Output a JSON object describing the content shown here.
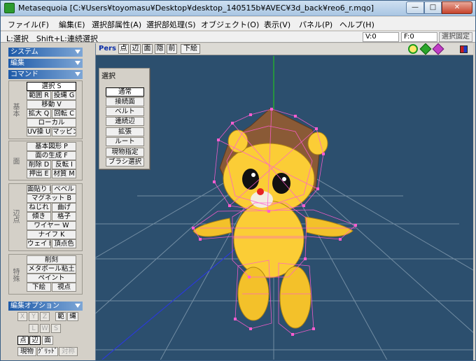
{
  "window": {
    "title": "Metasequoia [C:¥Users¥toyomasu¥Desktop¥desktop_140515b¥AVEC¥3d_back¥reo6_r.mqo]"
  },
  "menu": [
    "ファイル(F)",
    "編集(E)",
    "選択部属性(A)",
    "選択部処理(S)",
    "オブジェクト(O)",
    "表示(V)",
    "パネル(P)",
    "ヘルプ(H)"
  ],
  "status": {
    "hint": "L:選択　Shift+L:連続選択",
    "v": "V:0",
    "f": "F:0",
    "fixed": "選択固定"
  },
  "sections": {
    "system": "システム",
    "edit": "編集",
    "command": "コマンド",
    "edit_options": "編集オプション"
  },
  "groups": {
    "basic": "基本",
    "face": "面",
    "vertex": "辺点",
    "special": "特殊"
  },
  "basic_buttons": [
    "選択 S",
    "範囲 R",
    "投縄 G",
    "移動 V",
    "拡大 Q",
    "回転 C",
    "ローカル",
    "UV操 U",
    "マッピング"
  ],
  "face_buttons": [
    "基本図形 P",
    "面の生成 F",
    "削除 D",
    "反転 I",
    "押出 E",
    "材質 M"
  ],
  "vertex_buttons": [
    "面貼り H",
    "ベベル",
    "マグネット B",
    "ねじれ",
    "曲げ",
    "傾き",
    "格子",
    "ワイヤー W",
    "ナイフ K",
    "ウェイト",
    "頂点色"
  ],
  "special_buttons": [
    "削刻",
    "メタボール粘土",
    "ペイント",
    "下絵",
    "視点"
  ],
  "option_buttons": {
    "x": "X",
    "y": "Y",
    "z": "Z",
    "range": "範",
    "lasso": "縄",
    "l": "L",
    "w": "W",
    "s": "S",
    "point": "点",
    "edge": "辺",
    "face": "面",
    "current": "現物",
    "grid": "ｸﾞﾘｯﾄﾞ",
    "sym": "対称"
  },
  "viewport": {
    "pers": "Pers",
    "buttons": [
      "点",
      "辺",
      "面",
      "隠",
      "前",
      "下絵"
    ]
  },
  "select_panel": {
    "title": "選択",
    "buttons": [
      "通常",
      "接続面",
      "ベルト",
      "連続辺",
      "拡張",
      "ルート",
      "現物指定",
      "ブラシ選択"
    ]
  }
}
